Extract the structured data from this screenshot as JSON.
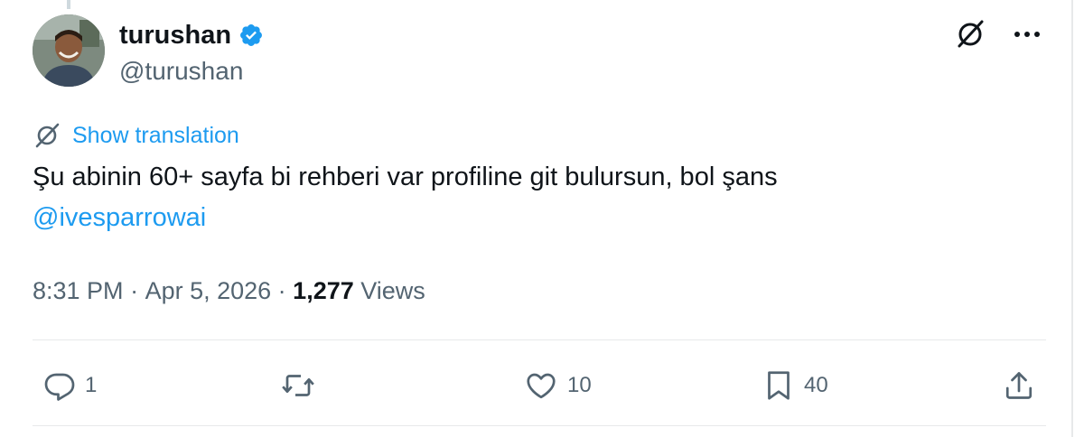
{
  "author": {
    "display_name": "turushan",
    "handle": "@turushan",
    "verified": true,
    "verified_color": "#1d9bf0"
  },
  "tweet": {
    "translate_label": "Show translation",
    "text": "Şu abinin 60+ sayfa bi rehberi var profiline git bulursun, bol şans",
    "mention": "@ivesparrowai"
  },
  "meta": {
    "time": "8:31 PM",
    "separator": " · ",
    "date": "Apr 5, 2026",
    "views_count": "1,277",
    "views_label": "Views"
  },
  "actions": {
    "replies": "1",
    "retweets": "",
    "likes": "10",
    "bookmarks": "40"
  },
  "icons": {
    "top_right": [
      "grok-icon",
      "more-icon"
    ],
    "translate": "translate-icon",
    "actions": [
      "reply-icon",
      "retweet-icon",
      "like-icon",
      "bookmark-icon",
      "share-icon"
    ]
  },
  "colors": {
    "accent": "#1d9bf0",
    "secondary_text": "#536471",
    "primary_text": "#0f1419"
  }
}
